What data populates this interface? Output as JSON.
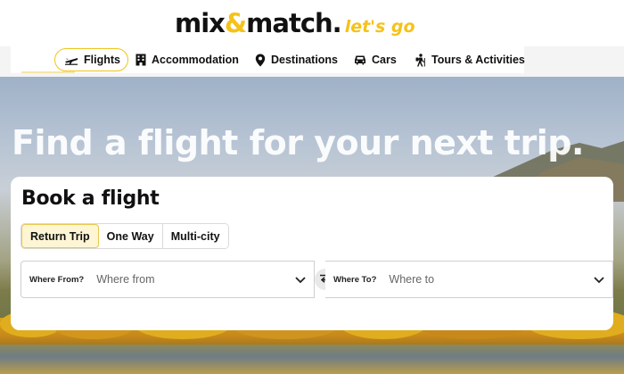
{
  "brand": {
    "name_part1": "mix",
    "name_amp": "&",
    "name_part2": "match.",
    "tagline": "let's go",
    "accent_color": "#f5c21a"
  },
  "nav": {
    "items": [
      {
        "label": "Flights",
        "icon": "plane-icon",
        "active": true
      },
      {
        "label": "Accommodation",
        "icon": "building-icon",
        "active": false
      },
      {
        "label": "Destinations",
        "icon": "map-pin-icon",
        "active": false
      },
      {
        "label": "Cars",
        "icon": "car-icon",
        "active": false
      },
      {
        "label": "Tours & Activities",
        "icon": "hiker-icon",
        "active": false
      }
    ]
  },
  "hero": {
    "title": "Find a flight for your next trip."
  },
  "booking": {
    "title": "Book a flight",
    "trip_types": [
      {
        "label": "Return Trip",
        "active": true
      },
      {
        "label": "One Way",
        "active": false
      },
      {
        "label": "Multi-city",
        "active": false
      }
    ],
    "from": {
      "label": "Where From?",
      "placeholder": "Where from",
      "value": ""
    },
    "to": {
      "label": "Where To?",
      "placeholder": "Where to",
      "value": ""
    }
  }
}
